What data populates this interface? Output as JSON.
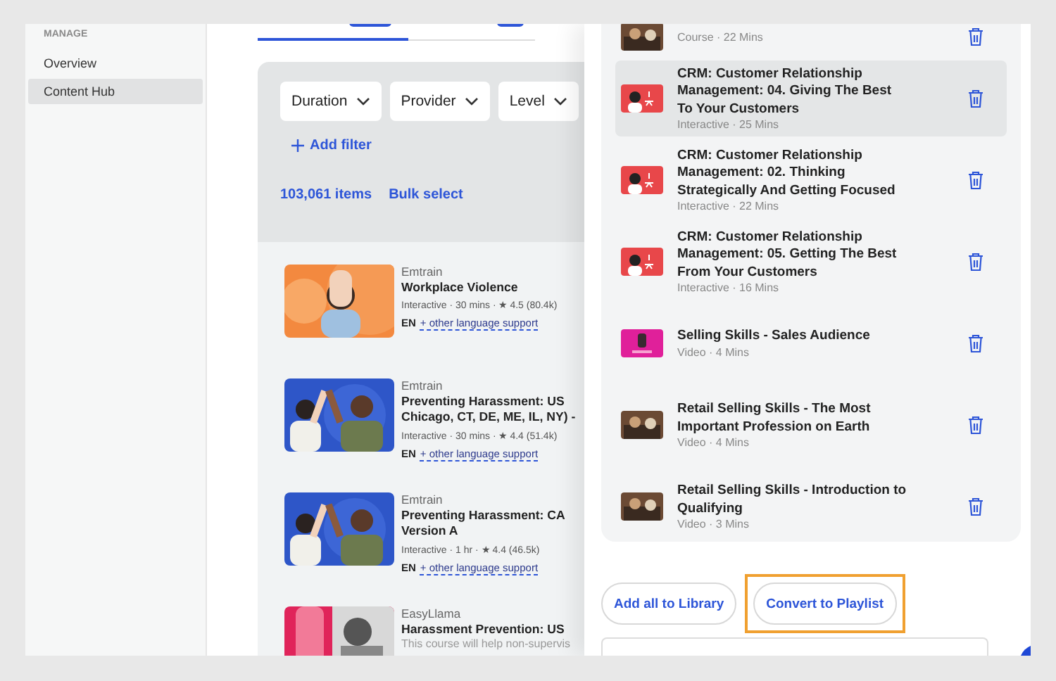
{
  "sidebar": {
    "section": "MANAGE",
    "items": [
      {
        "label": "Overview",
        "selected": false
      },
      {
        "label": "Content Hub",
        "selected": true
      }
    ]
  },
  "filters": [
    "Duration",
    "Provider",
    "Level"
  ],
  "add_filter": "Add filter",
  "item_count": "103,061 items",
  "bulk_select": "Bulk select",
  "results": [
    {
      "provider": "Emtrain",
      "title": "Workplace Violence",
      "meta": "Interactive · 30 mins · ★ 4.5 (80.4k)",
      "lang": "EN",
      "lang_link": "+ other language support",
      "kind": "picture"
    },
    {
      "provider": "Emtrain",
      "title": "Preventing Harassment: US Chicago, CT, DE, ME, IL, NY) -",
      "meta": "Interactive · 30 mins · ★ 4.4 (51.4k)",
      "lang": "EN",
      "lang_link": "+ other language support",
      "kind": "picture"
    },
    {
      "provider": "Emtrain",
      "title": "Preventing Harassment: CA Version A",
      "meta": "Interactive · 1 hr · ★ 4.4 (46.5k)",
      "lang": "EN",
      "lang_link": "+ other language support",
      "kind": "picture"
    },
    {
      "provider": "EasyLlama",
      "title": "Harassment Prevention: US",
      "description": "This course will help non-supervis",
      "kind": "picture"
    }
  ],
  "playlist": [
    {
      "meta": "Course · 22 Mins",
      "selected": false
    },
    {
      "title": "CRM: Customer Relationship Management: 04. Giving The Best To Your Customers",
      "meta": "Interactive · 25 Mins",
      "selected": true
    },
    {
      "title": "CRM: Customer Relationship Management: 02. Thinking Strategically And Getting Focused",
      "meta": "Interactive · 22 Mins",
      "selected": false
    },
    {
      "title": "CRM: Customer Relationship Management: 05. Getting The Best From Your Customers",
      "meta": "Interactive · 16 Mins",
      "selected": false
    },
    {
      "title": "Selling Skills - Sales Audience",
      "meta": "Video · 4 Mins",
      "selected": false
    },
    {
      "title": "Retail Selling Skills - The Most Important Profession on Earth",
      "meta": "Video · 4 Mins",
      "selected": false
    },
    {
      "title": "Retail Selling Skills - Introduction to Qualifying",
      "meta": "Video · 3 Mins",
      "selected": false
    }
  ],
  "actions": [
    {
      "label": "Add all to Library",
      "highlighted": false
    },
    {
      "label": "Convert to Playlist",
      "highlighted": true
    }
  ]
}
